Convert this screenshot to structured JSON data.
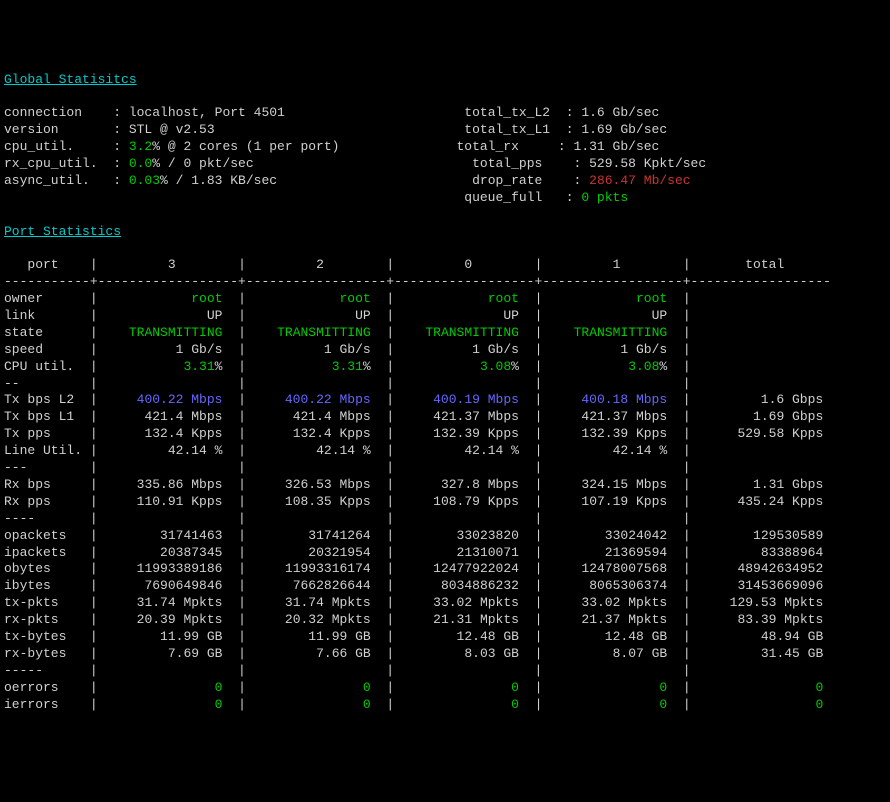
{
  "headers": {
    "global": "Global Statisitcs",
    "port": "Port Statistics"
  },
  "global_left": {
    "connection_label": "connection    : ",
    "connection_val": "localhost, Port 4501",
    "version_label": "version       : ",
    "version_val": "STL @ v2.53",
    "cpu_util_label": "cpu_util.     : ",
    "cpu_util_val": "3.2",
    "cpu_util_suffix": "% @ 2 cores (1 per port)",
    "rx_cpu_label": "rx_cpu_util.  : ",
    "rx_cpu_val": "0.0",
    "rx_cpu_suffix": "% / 0 pkt/sec",
    "async_label": "async_util.   : ",
    "async_val": "0.03",
    "async_suffix": "% / 1.83 KB/sec"
  },
  "global_right": {
    "tx_l2_label": "total_tx_L2  : ",
    "tx_l2_val": "1.6 Gb/sec",
    "tx_l1_label": "total_tx_L1  : ",
    "tx_l1_val": "1.69 Gb/sec",
    "rx_label": "total_rx     : ",
    "rx_val": "1.31 Gb/sec",
    "pps_label": "total_pps    : ",
    "pps_val": "529.58 Kpkt/sec",
    "drop_label": "drop_rate    : ",
    "drop_val": "286.47 Mb/sec",
    "queue_label": "queue_full   : ",
    "queue_val": "0 pkts"
  },
  "table": {
    "header": {
      "port": "   port    ",
      "c3": "         3        ",
      "c2": "         2        ",
      "c0": "         0        ",
      "c1": "         1        ",
      "total": "       total       "
    },
    "dashes1": "-----------+------------------+------------------+------------------+------------------+------------------ ",
    "owner": {
      "label": "owner      ",
      "p3": "            root  ",
      "p2": "            root  ",
      "p0": "            root  ",
      "p1": "            root  ",
      "t": "                   "
    },
    "link": {
      "label": "link       ",
      "p3": "              UP  ",
      "p2": "              UP  ",
      "p0": "              UP  ",
      "p1": "              UP  ",
      "t": "                   "
    },
    "state": {
      "label": "state      ",
      "p3": "    TRANSMITTING  ",
      "p2": "    TRANSMITTING  ",
      "p0": "    TRANSMITTING  ",
      "p1": "    TRANSMITTING  ",
      "t": "                   "
    },
    "speed": {
      "label": "speed      ",
      "p3": "          1 Gb/s  ",
      "p2": "          1 Gb/s  ",
      "p0": "          1 Gb/s  ",
      "p1": "          1 Gb/s  ",
      "t": "                   "
    },
    "cpu": {
      "label": "CPU util.  ",
      "p3": "           3.31",
      "pc": "%  ",
      "p2": "           3.31",
      "p0": "           3.08",
      "p1": "           3.08",
      "t": "                   "
    },
    "dashes2": "--         |                  |                  |                  |                  |                   ",
    "txl2": {
      "label": "Tx bps L2  ",
      "p3_b": "     400.22 Mbps",
      "p2_b": "     400.22 Mbps",
      "p0_b": "     400.19 Mbps",
      "p1_b": "     400.18 Mbps",
      "t": "         1.6 Gbps "
    },
    "txl1": {
      "label": "Tx bps L1  ",
      "p3": "      421.4 Mbps  ",
      "p2": "      421.4 Mbps  ",
      "p0": "     421.37 Mbps  ",
      "p1": "     421.37 Mbps  ",
      "t": "        1.69 Gbps "
    },
    "txpps": {
      "label": "Tx pps     ",
      "p3": "      132.4 Kpps  ",
      "p2": "      132.4 Kpps  ",
      "p0": "     132.39 Kpps  ",
      "p1": "     132.39 Kpps  ",
      "t": "      529.58 Kpps "
    },
    "lineu": {
      "label": "Line Util. ",
      "p3": "         42.14 %  ",
      "p2": "         42.14 %  ",
      "p0": "         42.14 %  ",
      "p1": "         42.14 %  ",
      "t": "                   "
    },
    "dashes3": "---        |                  |                  |                  |                  |                   ",
    "rxbps": {
      "label": "Rx bps     ",
      "p3": "     335.86 Mbps  ",
      "p2": "     326.53 Mbps  ",
      "p0": "      327.8 Mbps  ",
      "p1": "     324.15 Mbps  ",
      "t": "        1.31 Gbps "
    },
    "rxpps": {
      "label": "Rx pps     ",
      "p3": "     110.91 Kpps  ",
      "p2": "     108.35 Kpps  ",
      "p0": "     108.79 Kpps  ",
      "p1": "     107.19 Kpps  ",
      "t": "      435.24 Kpps "
    },
    "dashes4": "----       |                  |                  |                  |                  |                   ",
    "opkts": {
      "label": "opackets   ",
      "p3": "        31741463  ",
      "p2": "        31741264  ",
      "p0": "        33023820  ",
      "p1": "        33024042  ",
      "t": "        129530589 "
    },
    "ipkts": {
      "label": "ipackets   ",
      "p3": "        20387345  ",
      "p2": "        20321954  ",
      "p0": "        21310071  ",
      "p1": "        21369594  ",
      "t": "         83388964 "
    },
    "obytes": {
      "label": "obytes     ",
      "p3": "     11993389186  ",
      "p2": "     11993316174  ",
      "p0": "     12477922024  ",
      "p1": "     12478007568  ",
      "t": "      48942634952 "
    },
    "ibytes": {
      "label": "ibytes     ",
      "p3": "      7690649846  ",
      "p2": "      7662826644  ",
      "p0": "      8034886232  ",
      "p1": "      8065306374  ",
      "t": "      31453669096 "
    },
    "txpkts": {
      "label": "tx-pkts    ",
      "p3": "     31.74 Mpkts  ",
      "p2": "     31.74 Mpkts  ",
      "p0": "     33.02 Mpkts  ",
      "p1": "     33.02 Mpkts  ",
      "t": "     129.53 Mpkts "
    },
    "rxpkts": {
      "label": "rx-pkts    ",
      "p3": "     20.39 Mpkts  ",
      "p2": "     20.32 Mpkts  ",
      "p0": "     21.31 Mpkts  ",
      "p1": "     21.37 Mpkts  ",
      "t": "      83.39 Mpkts "
    },
    "txbytes": {
      "label": "tx-bytes   ",
      "p3": "        11.99 GB  ",
      "p2": "        11.99 GB  ",
      "p0": "        12.48 GB  ",
      "p1": "        12.48 GB  ",
      "t": "         48.94 GB "
    },
    "rxbytes": {
      "label": "rx-bytes   ",
      "p3": "         7.69 GB  ",
      "p2": "         7.66 GB  ",
      "p0": "         8.03 GB  ",
      "p1": "         8.07 GB  ",
      "t": "         31.45 GB "
    },
    "dashes5": "-----      |                  |                  |                  |                  |                   ",
    "oerr": {
      "label": "oerrors    ",
      "z": "               0  ",
      "zt": "                0 "
    },
    "ierr": {
      "label": "ierrors    ",
      "z": "               0  ",
      "zt": "                0 "
    }
  }
}
